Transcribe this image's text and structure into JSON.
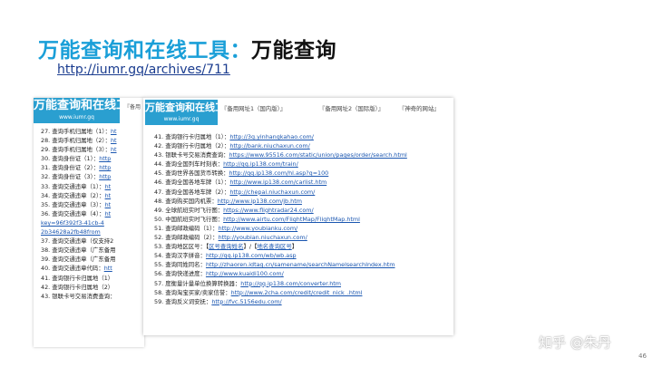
{
  "title": {
    "part1": "万能查询和在线工具：",
    "part2": "万能查询"
  },
  "link": "http://iumr.gq/archives/711",
  "logo": {
    "main": "万能查询和在线工具",
    "sub": "www.iumr.gq"
  },
  "tabs": [
    "『备用网址1（国内版）』",
    "『备用网址2（国际版）』",
    "『神奇的网站』"
  ],
  "back_tab_fragment": "『备用",
  "back_rows": [
    [
      {
        "t": "27. 查询手机归属地（1）：",
        "c": "n"
      },
      {
        "t": "ht",
        "c": "a"
      }
    ],
    [
      {
        "t": "28. 查询手机归属地（2）：",
        "c": "n"
      },
      {
        "t": "ht",
        "c": "a"
      }
    ],
    [
      {
        "t": "29. 查询手机归属地（3）：",
        "c": "n"
      },
      {
        "t": "ht",
        "c": "a"
      }
    ],
    [
      {
        "t": "30. 查询身份证（1）：",
        "c": "n"
      },
      {
        "t": "http",
        "c": "a"
      }
    ],
    [
      {
        "t": "31. 查询身份证（2）：",
        "c": "n"
      },
      {
        "t": "http",
        "c": "a"
      }
    ],
    [
      {
        "t": "32. 查询身份证（3）：",
        "c": "n"
      },
      {
        "t": "http",
        "c": "a"
      }
    ],
    [
      {
        "t": "33. 查询交通违章（1）：",
        "c": "n"
      },
      {
        "t": "ht",
        "c": "a"
      }
    ],
    [
      {
        "t": "34. 查询交通违章（2）：",
        "c": "n"
      },
      {
        "t": "ht",
        "c": "a"
      }
    ],
    [
      {
        "t": "35. 查询交通违章（3）：",
        "c": "n"
      },
      {
        "t": "ht",
        "c": "a"
      }
    ],
    [
      {
        "t": "36. 查询交通违章（4）：",
        "c": "n"
      },
      {
        "t": "ht",
        "c": "a"
      }
    ],
    [
      {
        "t": "key=96f392f3-41cb-4",
        "c": "a"
      }
    ],
    [
      {
        "t": "2b34628a2fb48from",
        "c": "a"
      }
    ],
    [
      {
        "t": "37. 查询交通违章（仅支持2",
        "c": "n"
      }
    ],
    [
      {
        "t": "38. 查询交通违章（广东备用",
        "c": "n"
      }
    ],
    [
      {
        "t": "39. 查询交通违章（广东备用",
        "c": "n"
      }
    ],
    [
      {
        "t": "40. 查询交通违章代码：",
        "c": "n"
      },
      {
        "t": "htt",
        "c": "a"
      }
    ],
    [
      {
        "t": "41. 查询银行卡归属地（1）",
        "c": "n"
      }
    ],
    [
      {
        "t": "42. 查询银行卡归属地（2）",
        "c": "n"
      }
    ],
    [
      {
        "t": "43. 银联卡号交易消费查询：",
        "c": "n"
      }
    ]
  ],
  "front_rows": [
    [
      {
        "t": "41. 查询银行卡归属地（1）：",
        "c": "n"
      },
      {
        "t": "http://3g.yinhangkahao.com/",
        "c": "a"
      }
    ],
    [
      {
        "t": "42. 查询银行卡归属地（2）：",
        "c": "n"
      },
      {
        "t": "http://bank.niuchaxun.com/",
        "c": "a"
      }
    ],
    [
      {
        "t": "43. 银联卡号交易消费查询：",
        "c": "n"
      },
      {
        "t": "https://www.95516.com/static/union/pages/order/search.html",
        "c": "a"
      }
    ],
    [
      {
        "t": "44. 查询全国列车时刻表：",
        "c": "n"
      },
      {
        "t": "http://qq.ip138.com/train/",
        "c": "a"
      }
    ],
    [
      {
        "t": "45. 查询世界各国货币转换：",
        "c": "n"
      },
      {
        "t": "http://qq.ip138.com/hl.asp?q=100",
        "c": "a"
      }
    ],
    [
      {
        "t": "46. 查询全国各地车牌（1）：",
        "c": "n"
      },
      {
        "t": "http://www.ip138.com/carlist.htm",
        "c": "a"
      }
    ],
    [
      {
        "t": "47. 查询全国各地车牌（2）：",
        "c": "n"
      },
      {
        "t": "http://chepai.niuchaxun.com/",
        "c": "a"
      }
    ],
    [
      {
        "t": "48. 查询购买国内机票：",
        "c": "n"
      },
      {
        "t": "http://www.ip138.com/jb.htm",
        "c": "a"
      }
    ],
    [
      {
        "t": "49. 全球航班实时飞行图：",
        "c": "n"
      },
      {
        "t": "https://www.flightradar24.com/",
        "c": "a"
      }
    ],
    [
      {
        "t": "50. 中国航班实时飞行图：",
        "c": "n"
      },
      {
        "t": "http://www.airtu.com/FlightMap/FlightMap.html",
        "c": "a"
      }
    ],
    [
      {
        "t": "51. 查询邮政编码（1）：",
        "c": "n"
      },
      {
        "t": "http://www.youbianku.com/",
        "c": "a"
      }
    ],
    [
      {
        "t": "52. 查询邮政编码（2）：",
        "c": "n"
      },
      {
        "t": "http://youbian.niuchaxun.com/",
        "c": "a"
      }
    ],
    [
      {
        "t": "53. 查询地区区号：【",
        "c": "n"
      },
      {
        "t": "区号查询姓名",
        "c": "a"
      },
      {
        "t": "】/【",
        "c": "n"
      },
      {
        "t": "地名查询区号",
        "c": "a"
      },
      {
        "t": "】",
        "c": "n"
      }
    ],
    [
      {
        "t": "54. 查询汉字拼音：",
        "c": "n"
      },
      {
        "t": "http://qq.ip138.com/wb/wb.asp",
        "c": "a"
      }
    ],
    [
      {
        "t": "55. 查询同姓同名：",
        "c": "n"
      },
      {
        "t": "http://zhaoren.idtag.cn/samename/searchNamelsearchIndex.htm",
        "c": "a"
      }
    ],
    [
      {
        "t": "56. 查询快递进度：",
        "c": "n"
      },
      {
        "t": "http://www.kuaidi100.com/",
        "c": "a"
      }
    ],
    [
      {
        "t": "57. 度衡量计量单位换算转换器：",
        "c": "n"
      },
      {
        "t": "http://qq.ip138.com/converter.htm",
        "c": "a"
      }
    ],
    [
      {
        "t": "58. 查询淘宝买家/卖家信誉：",
        "c": "n"
      },
      {
        "t": "http://www.2cha.com/credit/credit_nick_.html",
        "c": "a"
      }
    ],
    [
      {
        "t": "59. 查询反义词安抚：",
        "c": "n"
      },
      {
        "t": "http://fvc.5156edu.com/",
        "c": "a"
      }
    ]
  ],
  "watermark": "知乎 @朱丹",
  "page_number": "46",
  "colors": {
    "accent": "#1a9fd8",
    "link": "#1a56b0",
    "logo_bg": "#2a9fd0"
  }
}
